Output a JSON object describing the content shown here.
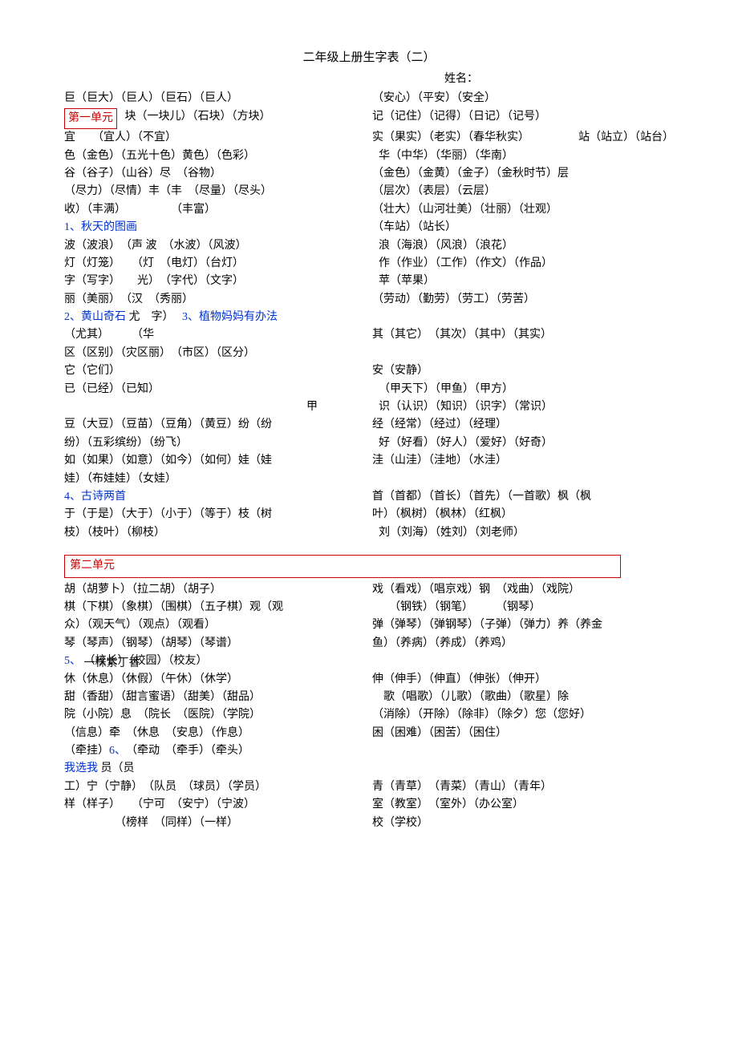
{
  "title": "二年级上册生字表（二）",
  "name_label": "姓名：",
  "unit1": {
    "label": "第一单元",
    "intro_left": "宜　　（宜人）（不宜）",
    "intro_left2": "色（金色）（五光十色）黄色）（色彩）",
    "intro_left3": "谷（谷子）（山谷）尽　（谷物）",
    "intro_left4": "（尽力）（尽情）丰（丰　（尽量）（尽头）",
    "intro_left5": "收）（丰满）　　　　　（丰富）",
    "overlap_line_a": "巨（巨大）（巨人）（巨石）（巨人）",
    "overlap_line_b": "块（一块儿）（石块）（方块）",
    "right_top1": "（安心）（平安）（安全）",
    "right_top2": "记（记住）（记得）（日记）（记号）",
    "right_top3": "站（站立）（站台）",
    "right1": "实（果实）（老实）（春华秋实）",
    "right2": "华（中华）（华丽）（华南）",
    "right3": "（金色）（金黄）（金子）（金秋时节）层",
    "right4": "（层次）（表层）（云层）",
    "right5": "（壮大）（山河壮美）（壮丽）（壮观）",
    "right6": "（车站）（站长）",
    "l1": {
      "label": "1、秋天的图画",
      "lines_left": [
        "波（波浪）　（声 波　（水波）（风波）",
        "灯（灯笼）　　（灯　（电灯）（台灯）",
        "字（写字）　　光）　（字代）（文字）",
        "丽（美丽）　（汉　（秀丽）"
      ],
      "lines_right": [
        "浪（海浪）（风浪）（浪花）",
        "作（作业）（工作）（作文）（作品）",
        "苹（苹果）",
        "（劳动）（勤劳）（劳工）（劳苦）"
      ]
    },
    "l2": {
      "label": "2、黄山奇石",
      "left_tail": "尤　字）",
      "lines_left_a": "（尤其）　　　（华",
      "lines_left_b": "区（区别）（灾区丽）　（市区）（区分）",
      "lines_left_c": "它（它们）",
      "lines_left_d": "已（已经）（已知）",
      "lines_left_e": "甲",
      "lines_left_f": "豆（大豆）（豆苗）（豆角）（黄豆）纷（纷",
      "lines_left_g": "纷）（五彩缤纷）（纷飞）",
      "lines_left_h": "如（如果）（如意）（如今）（如何）娃（娃",
      "lines_left_i": "娃）（布娃娃）（女娃）"
    },
    "l3": {
      "label": "3、植物妈妈有办法",
      "lines_right": [
        "其（其它）　（其次）（其中）（其实）",
        "",
        "安（安静）",
        "（甲天下）（甲鱼）（甲方）",
        "识（认识）（知识）（识字）（常识）",
        "经（经常）（经过）（经理）",
        "好（好看）（好人）（爱好）（好奇）",
        "洼（山洼）（洼地）（水洼）"
      ]
    },
    "l4": {
      "label": "4、古诗两首",
      "lines_left": [
        "于（于是）（大于）（小于）（等于）枝（树",
        "枝）（枝叶）（柳枝）"
      ],
      "lines_right": [
        "首（首都）（首长）（首先）（一首歌）枫（枫",
        "叶）（枫树）（枫林）（红枫）",
        "刘（刘海）（姓刘）（刘老师）"
      ]
    }
  },
  "unit2": {
    "label": "第二单元",
    "block1_left": [
      "胡（胡萝卜）（拉二胡）（胡子）",
      "棋（下棋）（象棋）（围棋）（五子棋）观（观",
      "众）（观天气）（观点）（观看）",
      "琴（琴声）（钢琴）（胡琴）（琴谱）"
    ],
    "block1_right": [
      "戏（看戏）（唱京戏）钢　（戏曲）（戏院）",
      "　　（钢铁）（钢笔）　　　（钢琴）",
      "弹（弹琴）（弹钢琴）（子弹）（弹力）养（养金",
      "鱼）（养病）（养成）（养鸡）"
    ],
    "l5": {
      "label": "5、",
      "overlap": "（校长）（校园）（校友）",
      "overlap_under": "一株紫丁香",
      "left": [
        "休（休息）（休假）（午休）（休学）",
        "甜（香甜）（甜言蜜语）（甜美）（甜品）",
        "院（小院）息　（院长　（医院）（学院）",
        "（信息）牵　（休息　（安息）（作息）",
        "（牵挂）6、　（牵动　（牵手）（牵头）"
      ],
      "right": [
        "伸（伸手）（伸直）（伸张）（伸开）",
        "　歌（唱歌）（儿歌）（歌曲）（歌星）除",
        "（消除）（开除）（除非）（除夕）您（您好）",
        "困（困难）（困苦）（困住）"
      ]
    },
    "l6": {
      "label": "我选我",
      "left_tail": "员（员",
      "left": [
        "工）宁（宁静）　（队员　（球员）（学员）",
        "样（样子）　　（宁可　（安宁）（宁波）",
        "　　　　　（榜样　（同样）（一样）"
      ],
      "right": [
        "青（青草）　（青菜）（青山）（青年）",
        "室（教室）　（室外）（办公室）",
        "校（学校）"
      ]
    }
  }
}
